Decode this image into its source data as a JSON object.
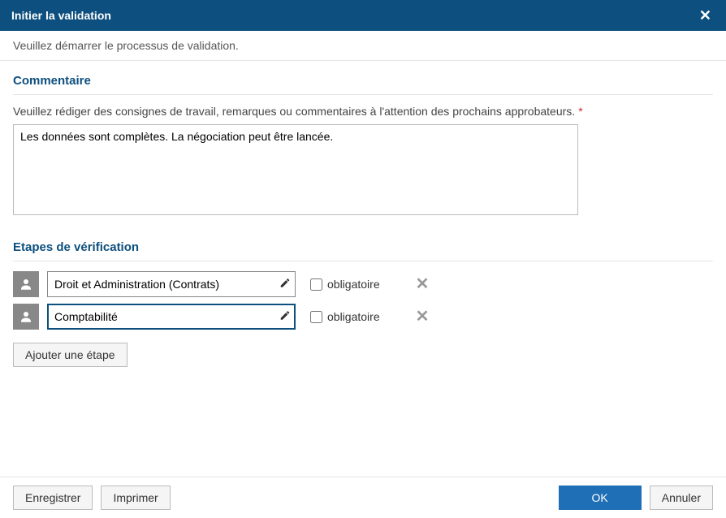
{
  "dialog": {
    "title": "Initier la validation",
    "subtitle": "Veuillez démarrer le processus de validation."
  },
  "comment": {
    "heading": "Commentaire",
    "label": "Veuillez rédiger des consignes de travail, remarques ou commentaires à l'attention des prochains approbateurs.",
    "value": "Les données sont complètes. La négociation peut être lancée."
  },
  "steps": {
    "heading": "Etapes de vérification",
    "mandatory_label": "obligatoire",
    "items": [
      {
        "value": "Droit et Administration (Contrats)",
        "mandatory": false
      },
      {
        "value": "Comptabilité",
        "mandatory": false
      }
    ],
    "add_label": "Ajouter une étape"
  },
  "footer": {
    "save": "Enregistrer",
    "print": "Imprimer",
    "ok": "OK",
    "cancel": "Annuler"
  }
}
